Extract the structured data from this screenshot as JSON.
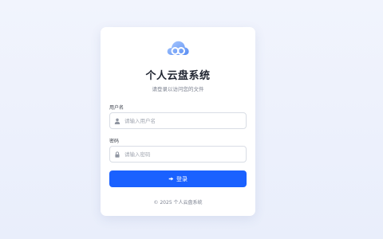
{
  "app": {
    "title": "个人云盘系统",
    "subtitle": "请登录以访问您的文件",
    "accent_color": "#1a61ff"
  },
  "form": {
    "username": {
      "label": "用户名",
      "placeholder": "请输入用户名",
      "value": "",
      "icon": "user-icon"
    },
    "password": {
      "label": "密码",
      "placeholder": "请输入密码",
      "value": "",
      "icon": "lock-icon"
    },
    "login_button": {
      "label": "登录",
      "icon": "sign-in-icon"
    }
  },
  "footer": {
    "copyright": "© 2025 个人云盘系统"
  },
  "logo": {
    "icon": "cloud-logo-icon"
  }
}
